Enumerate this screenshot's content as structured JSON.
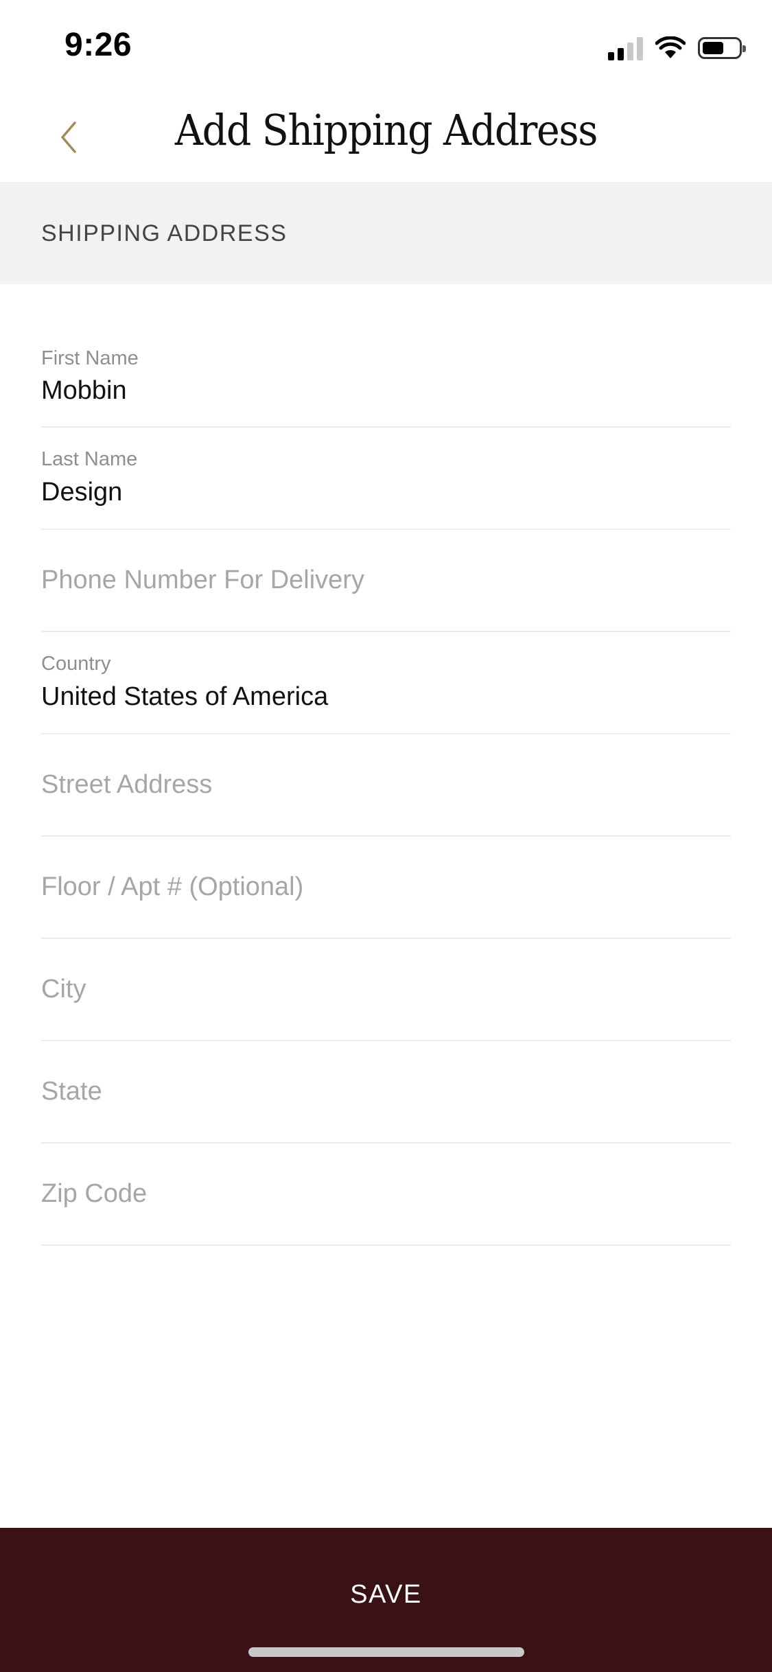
{
  "status_bar": {
    "time": "9:26",
    "icons": [
      "cellular-signal-icon",
      "wifi-icon",
      "battery-icon"
    ]
  },
  "nav": {
    "title": "Add Shipping Address",
    "back_icon": "chevron-left-icon"
  },
  "section": {
    "header": "SHIPPING ADDRESS"
  },
  "form": {
    "first_name": {
      "label": "First Name",
      "value": "Mobbin"
    },
    "last_name": {
      "label": "Last Name",
      "value": "Design"
    },
    "phone": {
      "placeholder": "Phone Number For Delivery"
    },
    "country": {
      "label": "Country",
      "value": "United States of America"
    },
    "street": {
      "placeholder": "Street Address"
    },
    "floor": {
      "placeholder": "Floor / Apt # (Optional)"
    },
    "city": {
      "placeholder": "City"
    },
    "state": {
      "placeholder": "State"
    },
    "zip": {
      "placeholder": "Zip Code"
    }
  },
  "actions": {
    "save_label": "SAVE"
  },
  "colors": {
    "accent": "#a48a5a",
    "save_bar": "#3a1215",
    "section_bg": "#f2f2f2"
  }
}
